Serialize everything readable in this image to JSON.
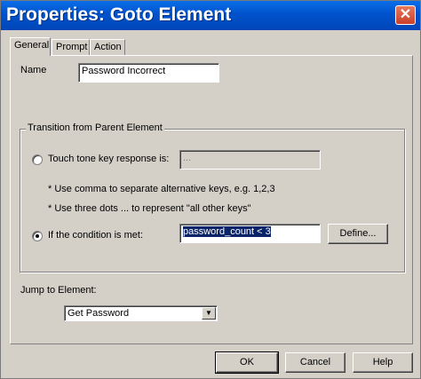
{
  "window": {
    "title": "Properties: Goto Element",
    "close_symbol": "✕"
  },
  "tabs": [
    {
      "label": "General"
    },
    {
      "label": "Prompt"
    },
    {
      "label": "Action"
    }
  ],
  "general": {
    "name_label": "Name",
    "name_value": "Password Incorrect",
    "transition_group_title": "Transition from Parent Element",
    "touch_tone_label": "Touch tone key response is:",
    "touch_tone_value": "...",
    "hint_comma": "* Use comma to separate alternative keys, e.g. 1,2,3",
    "hint_dots": "* Use three dots ... to represent \"all other keys\"",
    "condition_label": "If the condition is met:",
    "condition_value": "password_count < 3",
    "define_button": "Define...",
    "jump_label": "Jump to Element:",
    "jump_selected": "Get Password"
  },
  "footer": {
    "ok": "OK",
    "cancel": "Cancel",
    "help": "Help"
  }
}
